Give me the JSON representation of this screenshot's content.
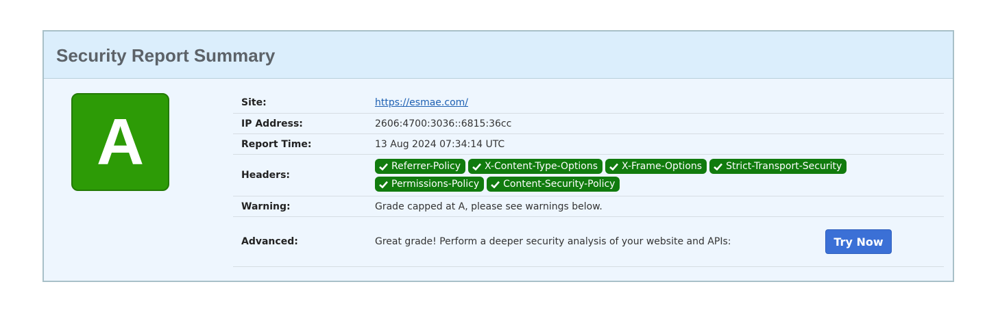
{
  "panel": {
    "title": "Security Report Summary"
  },
  "grade": {
    "letter": "A",
    "color": "#2d9b06"
  },
  "rows": {
    "site": {
      "label": "Site:",
      "value": "https://esmae.com/"
    },
    "ip": {
      "label": "IP Address:",
      "value": "2606:4700:3036::6815:36cc"
    },
    "report_time": {
      "label": "Report Time:",
      "value": "13 Aug 2024 07:34:14 UTC"
    },
    "headers": {
      "label": "Headers:",
      "items": [
        "Referrer-Policy",
        "X-Content-Type-Options",
        "X-Frame-Options",
        "Strict-Transport-Security",
        "Permissions-Policy",
        "Content-Security-Policy"
      ],
      "icon": "check-icon"
    },
    "warning": {
      "label": "Warning:",
      "value": "Grade capped at A, please see warnings below."
    },
    "advanced": {
      "label": "Advanced:",
      "value": "Great grade! Perform a deeper security analysis of your website and APIs:",
      "button_label": "Try Now"
    }
  },
  "colors": {
    "pill": "#117b0e",
    "button": "#3b70d6",
    "link": "#1c5fb2"
  }
}
